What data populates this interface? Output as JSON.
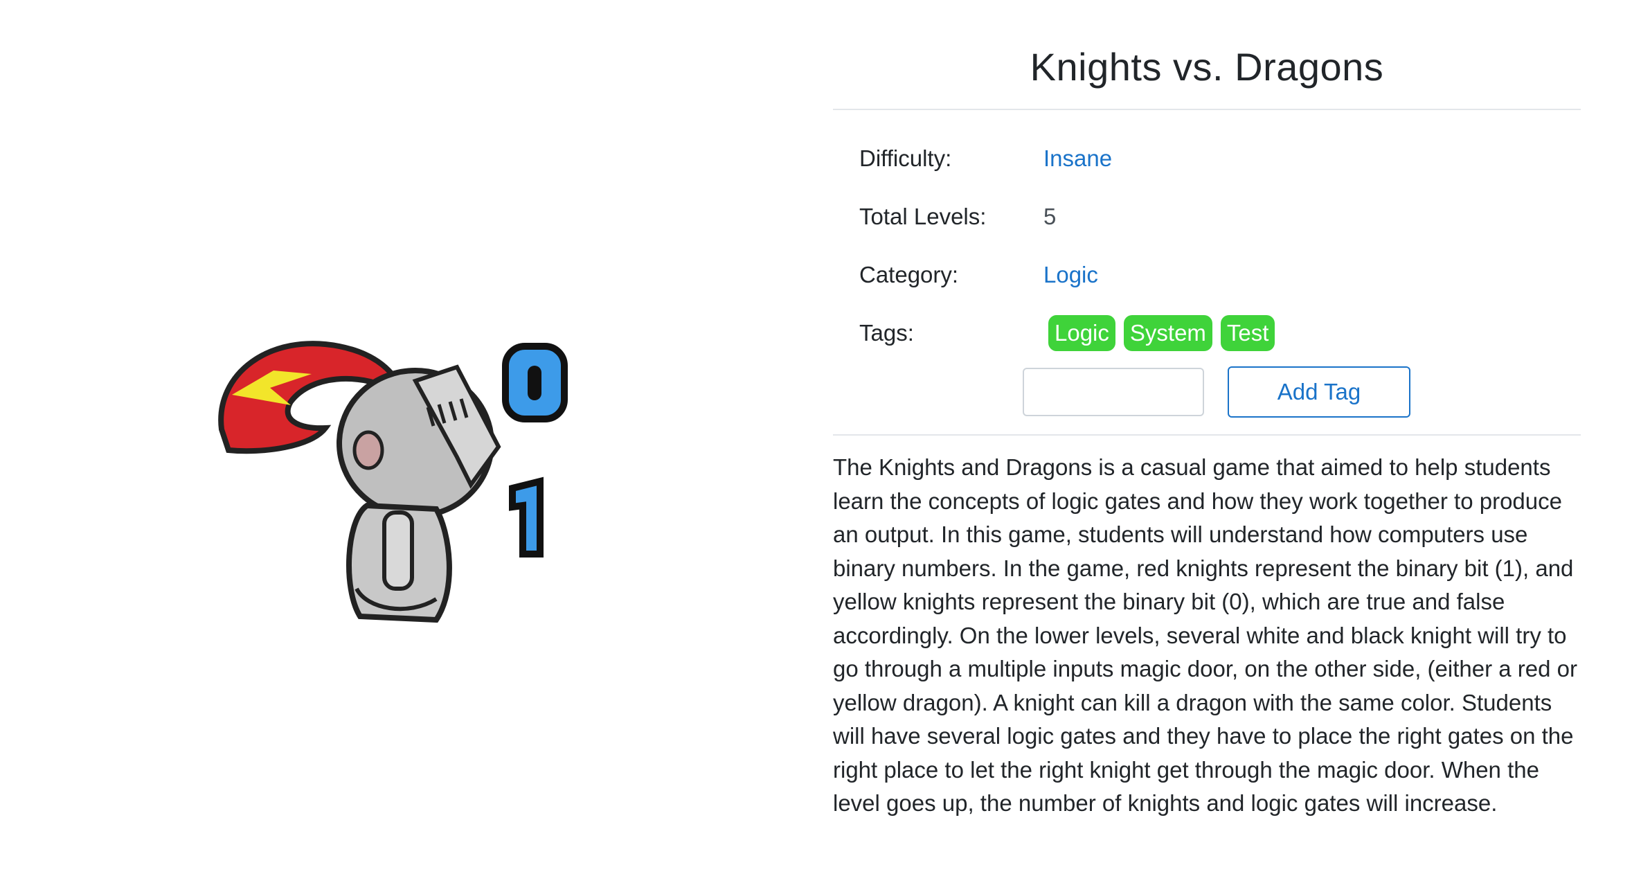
{
  "game": {
    "title": "Knights vs. Dragons",
    "details": {
      "difficulty_label": "Difficulty:",
      "difficulty_value": "Insane",
      "levels_label": "Total Levels:",
      "levels_value": "5",
      "category_label": "Category:",
      "category_value": "Logic",
      "tags_label": "Tags:"
    },
    "tags": [
      "Logic",
      "System",
      "Test"
    ],
    "add_tag": {
      "input_value": "",
      "input_placeholder": "",
      "button_label": "Add Tag"
    },
    "description": "The Knights and Dragons is a casual game that aimed to help students learn the concepts of logic gates and how they work together to produce an output. In this game, students will understand how computers use binary numbers. In the game, red knights represent the binary bit (1), and yellow knights represent the binary bit (0), which are true and false accordingly. On the lower levels, several white and black knight will try to go through a multiple inputs magic door, on the other side, (either a red or yellow dragon). A knight can kill a dragon with the same color. Students will have several logic gates and they have to place the right gates on the right place to let the right knight get through the magic door. When the level goes up, the number of knights and logic gates will increase.",
    "image": {
      "icon": "knight-icon",
      "digits": [
        "0",
        "1"
      ]
    }
  },
  "colors": {
    "link": "#1a73c9",
    "tag_bg": "#3fd33a",
    "digit_blue": "#3d9be9",
    "plume_red": "#d8252a",
    "plume_yellow": "#f2e52a"
  }
}
